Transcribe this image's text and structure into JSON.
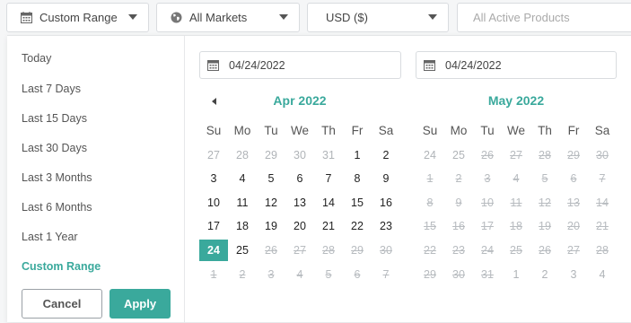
{
  "filters": {
    "range": "Custom Range",
    "market": "All Markets",
    "currency": "USD ($)",
    "products_placeholder": "All Active Products"
  },
  "presets": [
    "Today",
    "Last 7 Days",
    "Last 15 Days",
    "Last 30 Days",
    "Last 3 Months",
    "Last 6 Months",
    "Last 1 Year",
    "Custom Range"
  ],
  "active_preset": "Custom Range",
  "buttons": {
    "cancel": "Cancel",
    "apply": "Apply"
  },
  "date_inputs": {
    "start": "04/24/2022",
    "end": "04/24/2022"
  },
  "weekdays": [
    "Su",
    "Mo",
    "Tu",
    "We",
    "Th",
    "Fr",
    "Sa"
  ],
  "calendars": [
    {
      "title": "Apr 2022",
      "weeks": [
        [
          "27",
          "28",
          "29",
          "30",
          "31",
          "1",
          "2"
        ],
        [
          "3",
          "4",
          "5",
          "6",
          "7",
          "8",
          "9"
        ],
        [
          "10",
          "11",
          "12",
          "13",
          "14",
          "15",
          "16"
        ],
        [
          "17",
          "18",
          "19",
          "20",
          "21",
          "22",
          "23"
        ],
        [
          "24",
          "25",
          "26",
          "27",
          "28",
          "29",
          "30"
        ],
        [
          "1",
          "2",
          "3",
          "4",
          "5",
          "6",
          "7"
        ]
      ],
      "states": [
        [
          "out",
          "out",
          "out",
          "out",
          "out",
          "day",
          "day"
        ],
        [
          "day",
          "day",
          "day",
          "day",
          "day",
          "day",
          "day"
        ],
        [
          "day",
          "day",
          "day",
          "day",
          "day",
          "day",
          "day"
        ],
        [
          "day",
          "day",
          "day",
          "day",
          "day",
          "day",
          "day"
        ],
        [
          "sel",
          "day",
          "dis",
          "dis",
          "dis",
          "dis",
          "dis"
        ],
        [
          "dis",
          "dis",
          "dis",
          "dis",
          "dis",
          "dis",
          "dis"
        ]
      ]
    },
    {
      "title": "May 2022",
      "weeks": [
        [
          "24",
          "25",
          "26",
          "27",
          "28",
          "29",
          "30"
        ],
        [
          "1",
          "2",
          "3",
          "4",
          "5",
          "6",
          "7"
        ],
        [
          "8",
          "9",
          "10",
          "11",
          "12",
          "13",
          "14"
        ],
        [
          "15",
          "16",
          "17",
          "18",
          "19",
          "20",
          "21"
        ],
        [
          "22",
          "23",
          "24",
          "25",
          "26",
          "27",
          "28"
        ],
        [
          "29",
          "30",
          "31",
          "1",
          "2",
          "3",
          "4"
        ]
      ],
      "states": [
        [
          "out",
          "out",
          "dis",
          "dis",
          "dis",
          "dis",
          "dis"
        ],
        [
          "dis",
          "dis",
          "dis",
          "dis",
          "dis",
          "dis",
          "dis"
        ],
        [
          "dis",
          "dis",
          "dis",
          "dis",
          "dis",
          "dis",
          "dis"
        ],
        [
          "dis",
          "dis",
          "dis",
          "dis",
          "dis",
          "dis",
          "dis"
        ],
        [
          "dis",
          "dis",
          "dis",
          "dis",
          "dis",
          "dis",
          "dis"
        ],
        [
          "dis",
          "dis",
          "dis",
          "out",
          "out",
          "out",
          "out"
        ]
      ]
    }
  ],
  "icons": {
    "range": "calendar-icon",
    "market": "globe-icon",
    "date_input": "calendar-icon",
    "prev": "chevron-left-icon"
  },
  "colors": {
    "accent": "#3aa99c"
  }
}
